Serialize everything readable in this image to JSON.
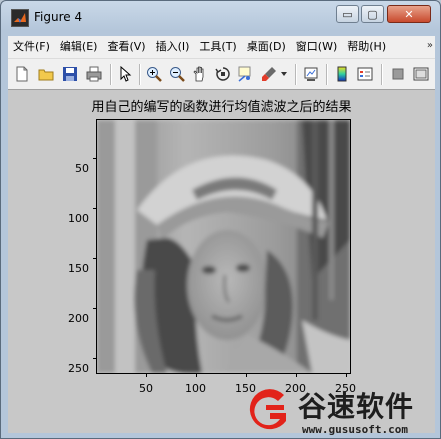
{
  "window": {
    "title": "Figure 4",
    "buttons": {
      "minimize": "▭",
      "maximize": "▢",
      "close": "✕"
    }
  },
  "menubar": {
    "items": [
      {
        "label": "文件(F)"
      },
      {
        "label": "编辑(E)"
      },
      {
        "label": "查看(V)"
      },
      {
        "label": "插入(I)"
      },
      {
        "label": "工具(T)"
      },
      {
        "label": "桌面(D)"
      },
      {
        "label": "窗口(W)"
      },
      {
        "label": "帮助(H)"
      }
    ],
    "overflow": "»"
  },
  "toolbar": {
    "icons": [
      "new-figure-icon",
      "open-file-icon",
      "save-icon",
      "print-icon",
      "edit-plot-arrow-icon",
      "zoom-in-icon",
      "zoom-out-icon",
      "pan-hand-icon",
      "rotate-3d-icon",
      "data-cursor-icon",
      "brush-icon",
      "link-plot-icon",
      "colorbar-icon",
      "legend-icon",
      "hide-plot-tools-icon",
      "show-plot-tools-icon"
    ]
  },
  "figure": {
    "title": "用自己的编写的函数进行均值滤波之后的结果",
    "image": "grayscale portrait photo (Lena), mean-filtered",
    "yticks": [
      "50",
      "100",
      "150",
      "200",
      "250"
    ],
    "xticks": [
      "50",
      "100",
      "150",
      "200",
      "250"
    ]
  },
  "watermark": {
    "brand": "谷速软件",
    "url": "www.gususoft.com",
    "color": "#e2231a"
  }
}
